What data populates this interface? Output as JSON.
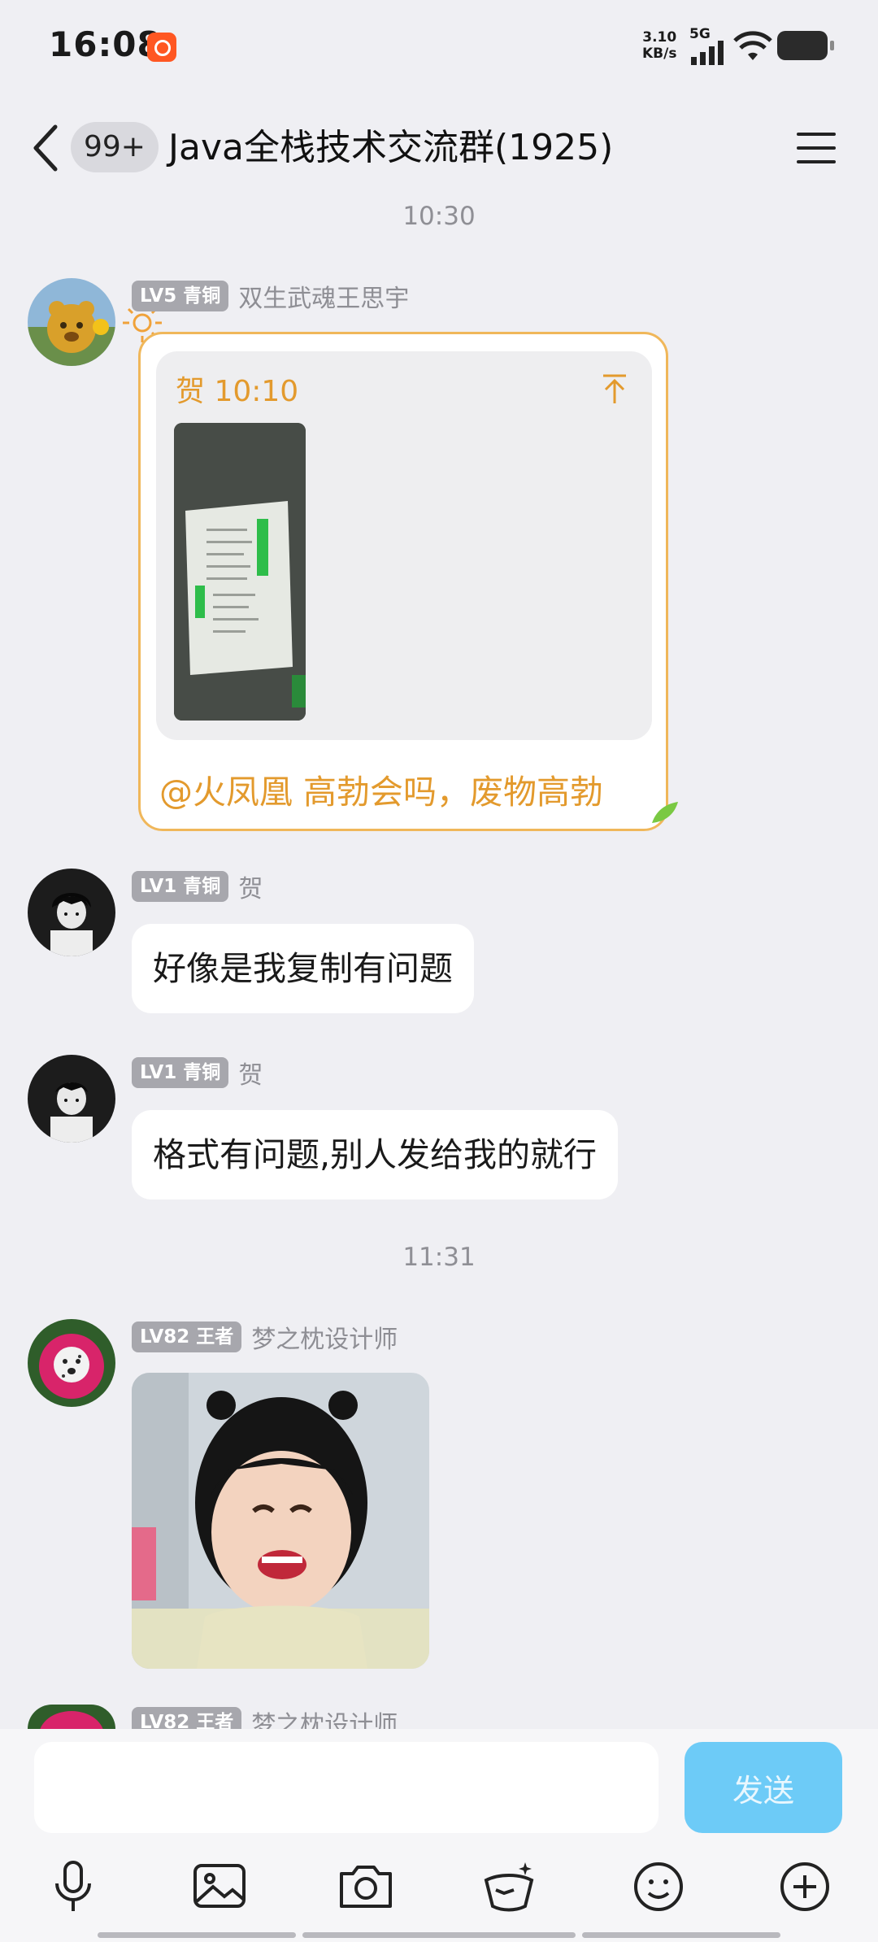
{
  "status_bar": {
    "time": "16:08",
    "net_speed_value": "3.10",
    "net_speed_unit": "KB/s",
    "network": "5G"
  },
  "header": {
    "unread_count": "99+",
    "title": "Java全栈技术交流群(1925)"
  },
  "messages": [
    {
      "type": "time",
      "text": "10:30"
    },
    {
      "type": "quote",
      "level": "LV5 青铜",
      "sender": "双生武魂王思宇",
      "quote_meta": "贺 10:10",
      "text": "@火凤凰 高勃会吗，废物高勃"
    },
    {
      "type": "text",
      "level": "LV1 青铜",
      "sender": "贺",
      "text": "好像是我复制有问题"
    },
    {
      "type": "text",
      "level": "LV1 青铜",
      "sender": "贺",
      "text": "格式有问题,别人发给我的就行"
    },
    {
      "type": "time",
      "text": "11:31"
    },
    {
      "type": "image",
      "level": "LV82 王者",
      "sender": "梦之枕设计师"
    },
    {
      "type": "partial",
      "level": "LV82 王者",
      "sender": "梦之枕设计师"
    }
  ],
  "input": {
    "placeholder": "",
    "send_label": "发送"
  },
  "toolbar": [
    "mic-icon",
    "image-icon",
    "camera-icon",
    "red-packet-icon",
    "emoji-icon",
    "plus-icon"
  ],
  "colors": {
    "accent": "#e39a2d",
    "send": "#6dcbf7",
    "background": "#efeff3"
  }
}
